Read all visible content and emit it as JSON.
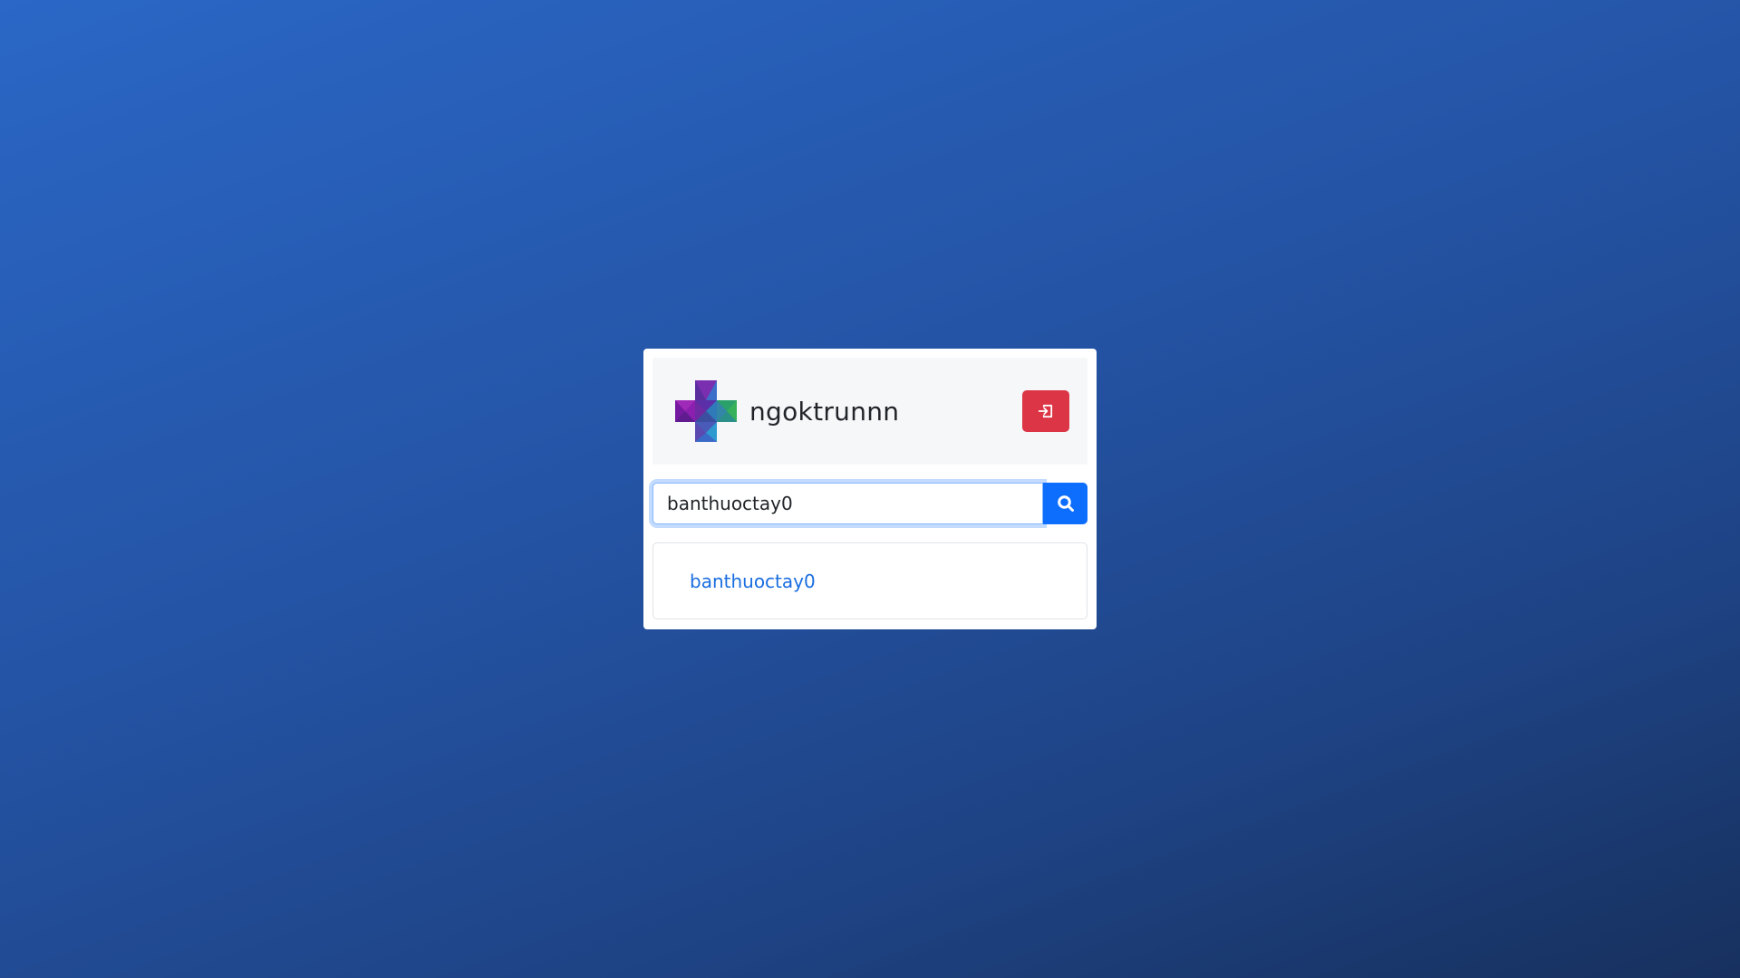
{
  "header": {
    "logo_icon": "medical-cross-logo",
    "username": "ngoktrunnn",
    "logout_icon": "sign-in-icon",
    "logout_color": "#dc3545"
  },
  "search": {
    "value": "banthuoctay0",
    "button_icon": "search-icon",
    "button_color": "#0d6efd"
  },
  "results": {
    "items": [
      {
        "label": "banthuoctay0"
      }
    ]
  }
}
